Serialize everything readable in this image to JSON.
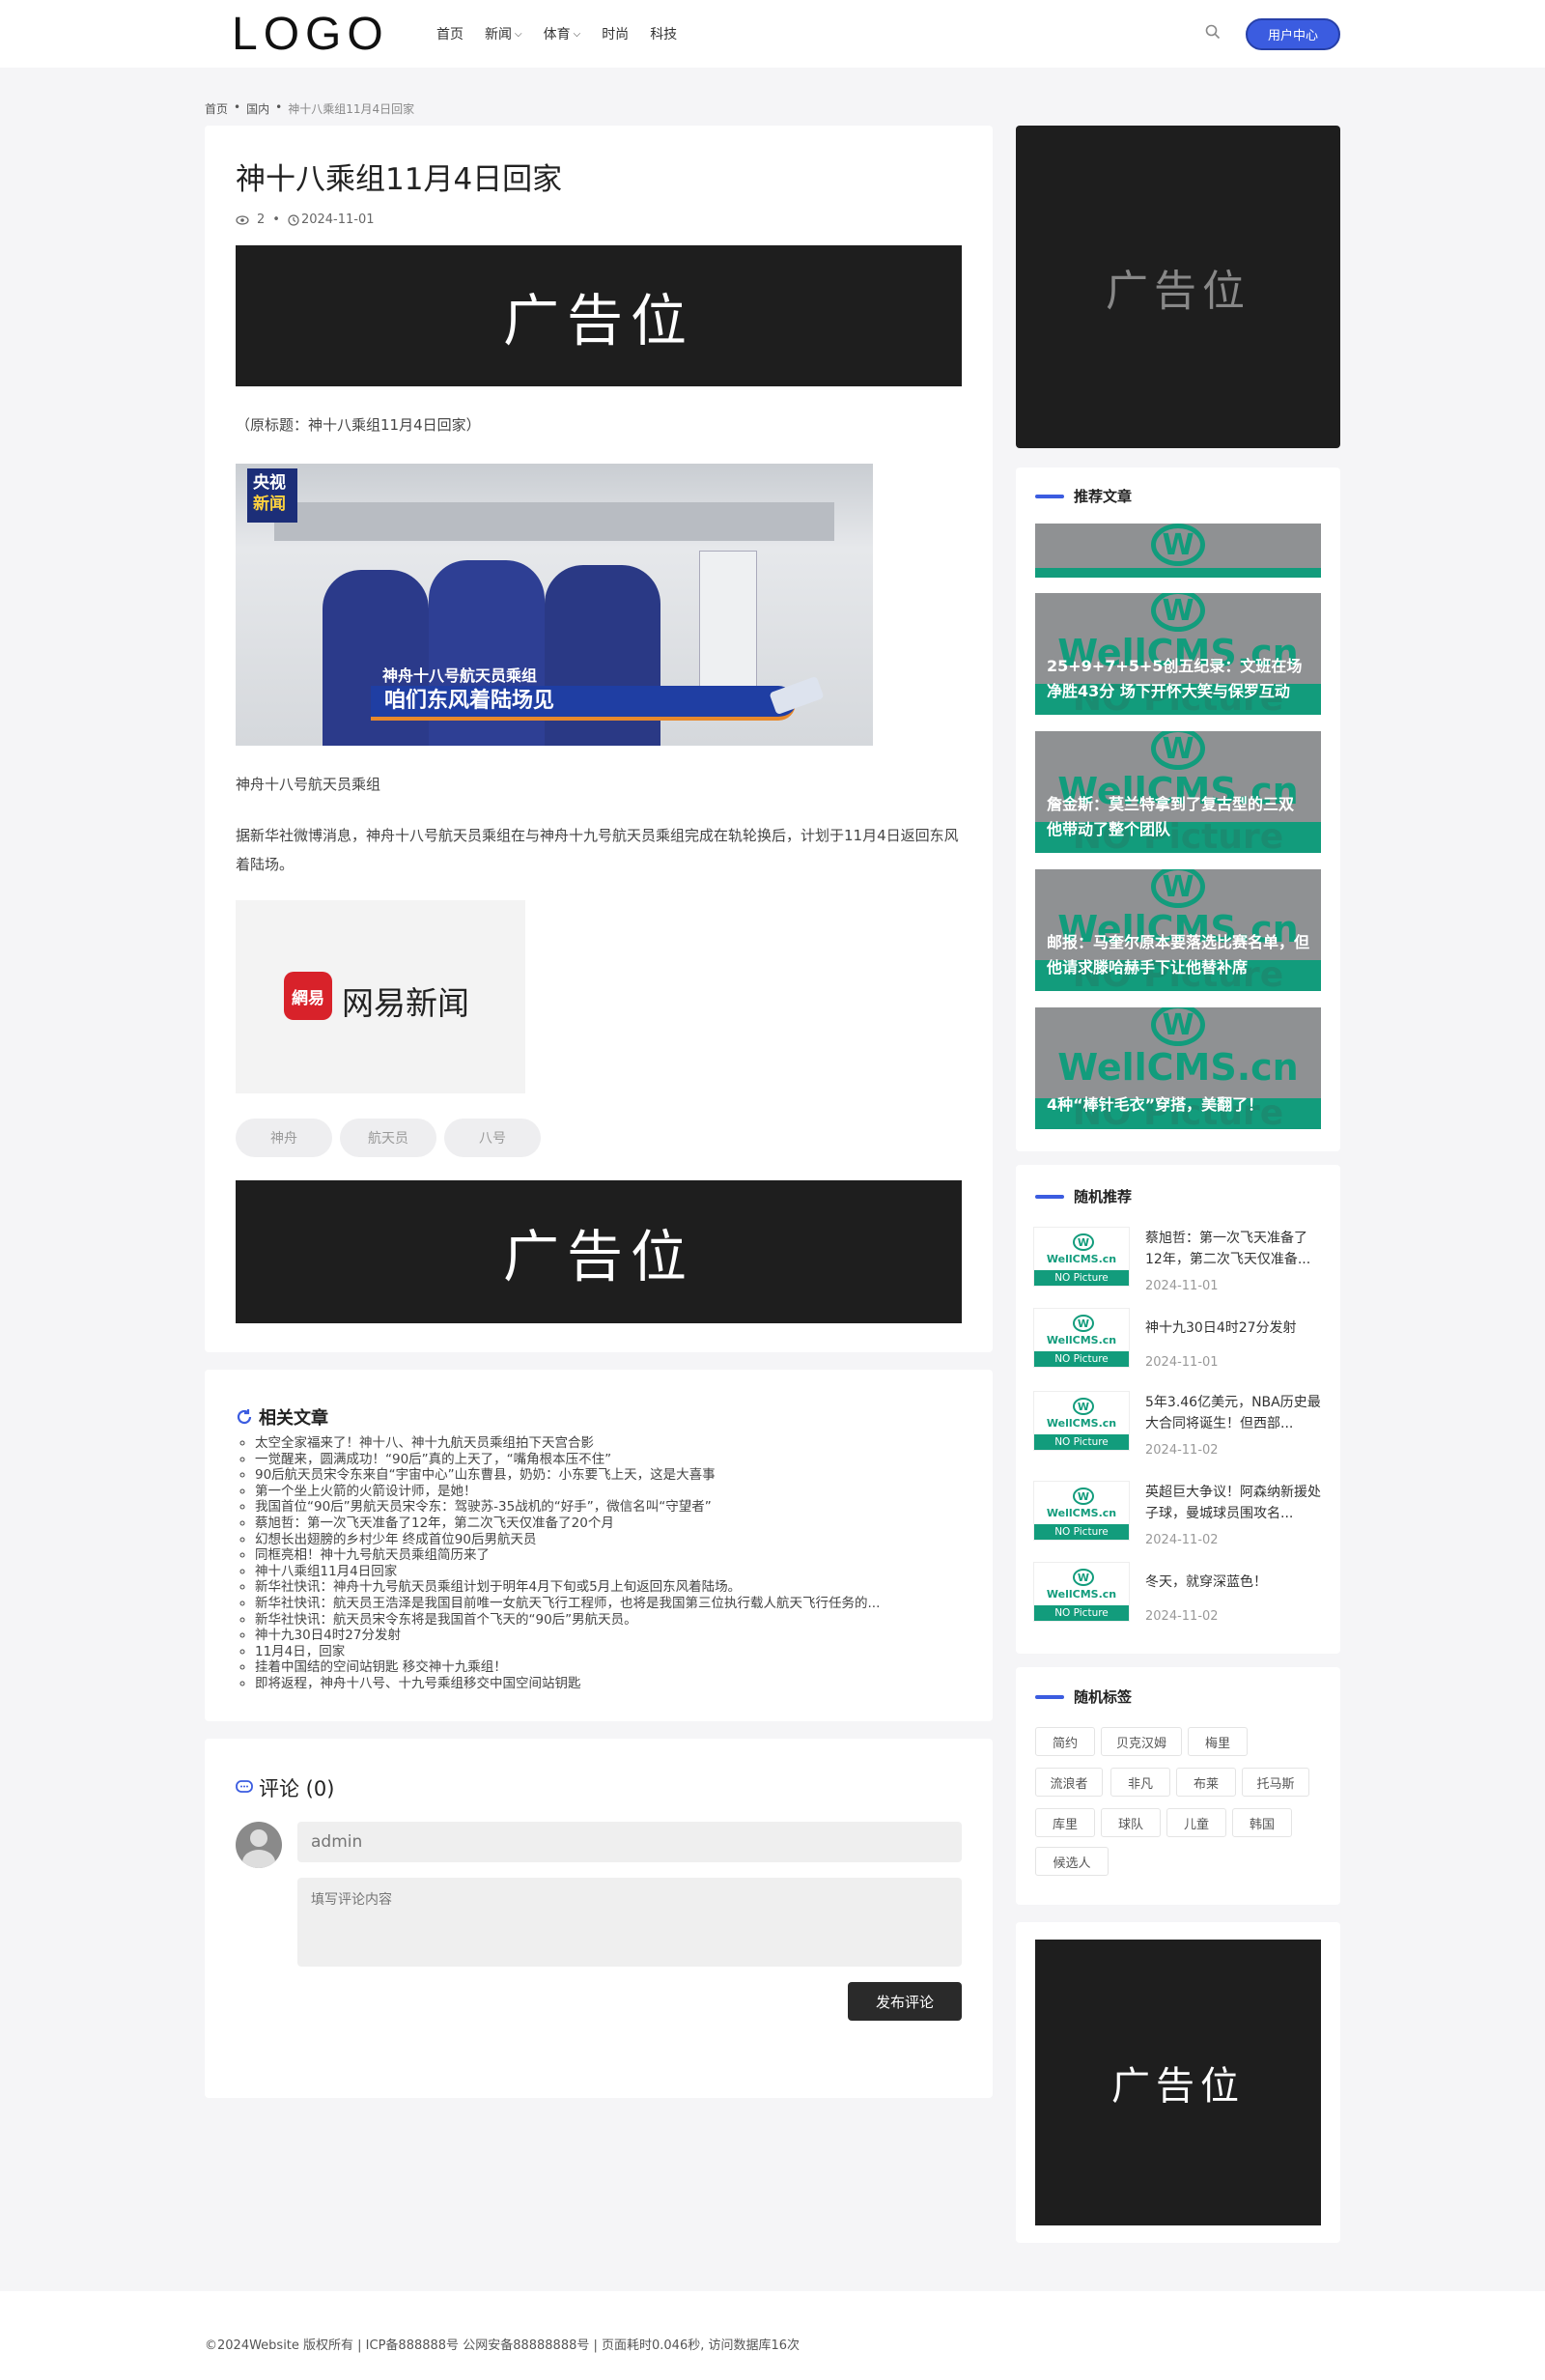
{
  "header": {
    "logo": "LOGO",
    "nav": [
      {
        "label": "首页",
        "has_dropdown": false
      },
      {
        "label": "新闻",
        "has_dropdown": true
      },
      {
        "label": "体育",
        "has_dropdown": true
      },
      {
        "label": "时尚",
        "has_dropdown": false
      },
      {
        "label": "科技",
        "has_dropdown": false
      }
    ],
    "user_center": "用户中心"
  },
  "breadcrumb": [
    "首页",
    "国内",
    "神十八乘组11月4日回家"
  ],
  "article": {
    "title": "神十八乘组11月4日回家",
    "views": "2",
    "date": "2024-11-01",
    "ad_label": "广告位",
    "original_title": "（原标题：神十八乘组11月4日回家）",
    "image": {
      "badge_line1": "央视",
      "badge_line2": "新闻",
      "caption_small": "神舟十八号航天员乘组",
      "caption_big": "咱们东风着陆场见"
    },
    "image_caption": "神舟十八号航天员乘组",
    "paragraph": "据新华社微博消息，神舟十八号航天员乘组在与神舟十九号航天员乘组完成在轨轮换后，计划于11月4日返回东风着陆场。",
    "netease_icon": "網易",
    "netease_name": "网易新闻",
    "tags": [
      "神舟",
      "航天员",
      "八号"
    ]
  },
  "related": {
    "title": "相关文章",
    "items": [
      "太空全家福来了！神十八、神十九航天员乘组拍下天宫合影",
      "一觉醒来，圆满成功！“90后”真的上天了，“嘴角根本压不住”",
      "90后航天员宋令东来自“宇宙中心”山东曹县，奶奶：小东要飞上天，这是大喜事",
      "第一个坐上火箭的火箭设计师，是她！",
      "我国首位“90后”男航天员宋令东：驾驶苏-35战机的“好手”，微信名叫“守望者”",
      "蔡旭哲：第一次飞天准备了12年，第二次飞天仅准备了20个月",
      "幻想长出翅膀的乡村少年 终成首位90后男航天员",
      "同框亮相！神十九号航天员乘组简历来了",
      "神十八乘组11月4日回家",
      "新华社快讯：神舟十九号航天员乘组计划于明年4月下旬或5月上旬返回东风着陆场。",
      "新华社快讯：航天员王浩泽是我国目前唯一女航天飞行工程师，也将是我国第三位执行载人航天飞行任务的...",
      "新华社快讯：航天员宋令东将是我国首个飞天的“90后”男航天员。",
      "神十九30日4时27分发射",
      "11月4日，回家",
      "挂着中国结的空间站钥匙 移交神十九乘组！",
      "即将返程，神舟十八号、十九号乘组移交中国空间站钥匙"
    ]
  },
  "comments": {
    "title": "评论 (0)",
    "name_placeholder": "admin",
    "content_placeholder": "填写评论内容",
    "submit": "发布评论"
  },
  "sidebar": {
    "ad_label": "广告位",
    "recommended": {
      "title": "推荐文章",
      "brand": "WellCMS.cn",
      "no_picture": "NO Picture",
      "items": [
        "",
        "25+9+7+5+5创五纪录：文班在场净胜43分 场下开怀大笑与保罗互动",
        "詹金斯：莫兰特拿到了复古型的三双 他带动了整个团队",
        "邮报：马奎尔原本要落选比赛名单，但他请求滕哈赫手下让他替补席",
        "4种“棒针毛衣”穿搭，美翻了！"
      ]
    },
    "random": {
      "title": "随机推荐",
      "thumb_brand": "WellCMS.cn",
      "thumb_label": "NO Picture",
      "items": [
        {
          "title": "蔡旭哲：第一次飞天准备了12年，第二次飞天仅准备...",
          "date": "2024-11-01"
        },
        {
          "title": "神十九30日4时27分发射",
          "date": "2024-11-01"
        },
        {
          "title": "5年3.46亿美元，NBA历史最大合同将诞生！但西部...",
          "date": "2024-11-02"
        },
        {
          "title": "英超巨大争议！阿森纳新援处子球，曼城球员围攻名...",
          "date": "2024-11-02"
        },
        {
          "title": "冬天，就穿深蓝色！",
          "date": "2024-11-02"
        }
      ]
    },
    "tags": {
      "title": "随机标签",
      "items": [
        "简约",
        "贝克汉姆",
        "梅里",
        "流浪者",
        "非凡",
        "布莱",
        "托马斯",
        "库里",
        "球队",
        "儿童",
        "韩国",
        "候选人"
      ]
    },
    "ad_label_bottom": "广告位"
  },
  "footer": "©2024Website 版权所有 | ICP备888888号  公网安备88888888号 | 页面耗时0.046秒, 访问数据库16次",
  "colors": {
    "accent": "#3b5ce0",
    "brand_green": "#129c7c",
    "ad_bg": "#1e1e1e"
  }
}
